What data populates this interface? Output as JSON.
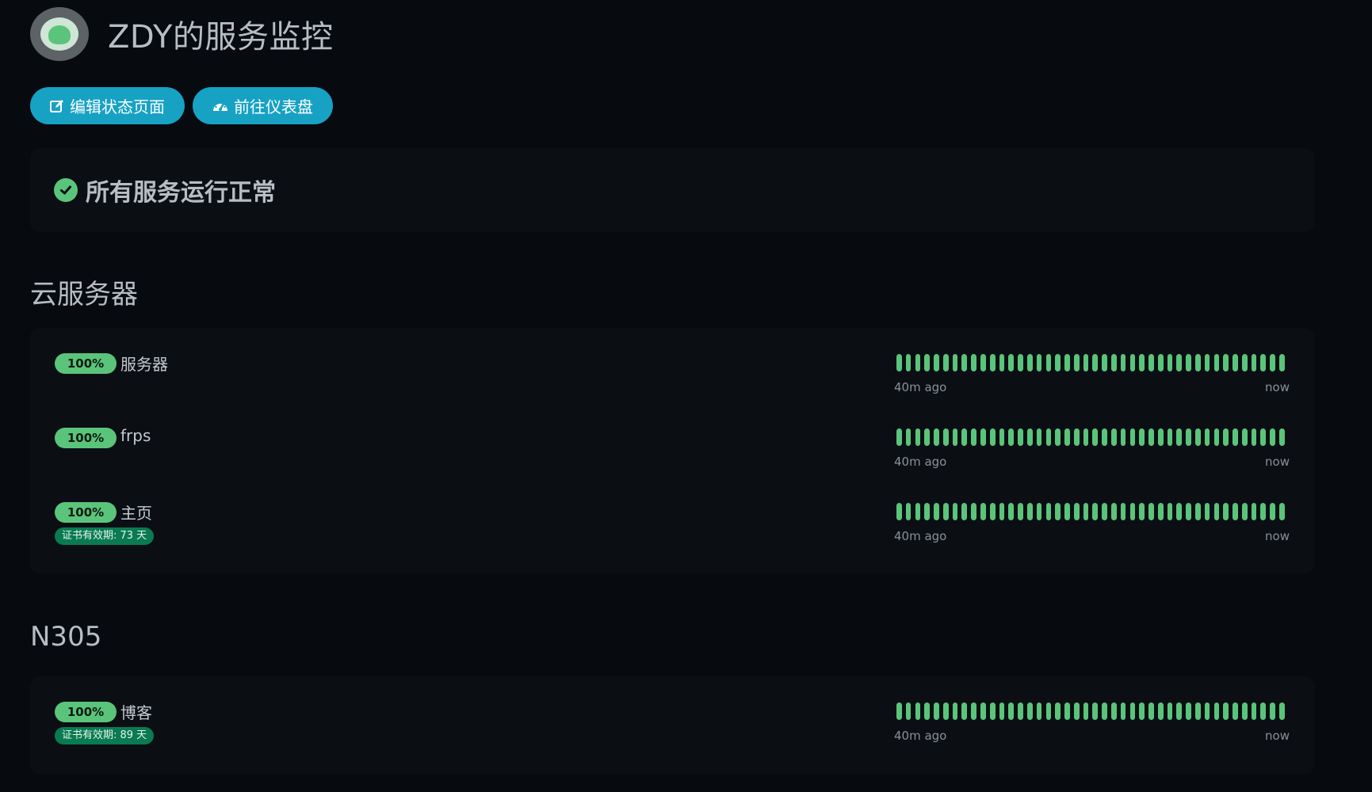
{
  "header": {
    "title": "ZDY的服务监控",
    "logo": "status-page-logo"
  },
  "actions": {
    "edit_label": "编辑状态页面",
    "edit_icon": "edit-icon",
    "dashboard_label": "前往仪表盘",
    "dashboard_icon": "tachometer-icon"
  },
  "overall_status": {
    "text": "所有服务运行正常",
    "icon": "check-circle-icon",
    "color": "#5bc47b"
  },
  "colors": {
    "accent": "#17a2c4",
    "up": "#5bc47b",
    "cert_badge": "#0a7a52",
    "background": "#070a0f",
    "card": "#0b0f14"
  },
  "groups": [
    {
      "title": "云服务器",
      "monitors": [
        {
          "uptime": "100%",
          "name": "服务器",
          "cert": null,
          "beats_up": 42,
          "time_start": "40m ago",
          "time_end": "now"
        },
        {
          "uptime": "100%",
          "name": "frps",
          "cert": null,
          "beats_up": 42,
          "time_start": "40m ago",
          "time_end": "now"
        },
        {
          "uptime": "100%",
          "name": "主页",
          "cert": "证书有效期: 73 天",
          "beats_up": 42,
          "time_start": "40m ago",
          "time_end": "now"
        }
      ]
    },
    {
      "title": "N305",
      "monitors": [
        {
          "uptime": "100%",
          "name": "博客",
          "cert": "证书有效期: 89 天",
          "beats_up": 42,
          "time_start": "40m ago",
          "time_end": "now"
        }
      ]
    }
  ]
}
